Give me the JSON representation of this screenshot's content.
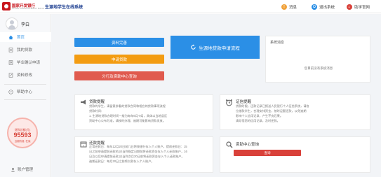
{
  "header": {
    "brand": "国家开发银行",
    "brand_sub": "CHINA DEVELOPMENT BANK",
    "system_title": "生源地学生在线系统",
    "links": [
      {
        "label": "消息",
        "icon": "bell-icon",
        "color": "#f0a23b"
      },
      {
        "label": "退出系统",
        "icon": "logout-icon",
        "color": "#2b8fe6"
      },
      {
        "label": "助学官网",
        "icon": "home-icon",
        "color": "#d9413a"
      }
    ]
  },
  "sidebar": {
    "username": "李白",
    "items": [
      {
        "label": "首页",
        "icon": "home-icon"
      },
      {
        "label": "我的贷款",
        "icon": "loan-icon"
      },
      {
        "label": "毕业确认申请",
        "icon": "graduation-icon"
      },
      {
        "label": "资料修改",
        "icon": "edit-icon"
      },
      {
        "label": "帮助中心",
        "icon": "help-icon"
      }
    ],
    "gauge": {
      "caption": "贷款总额(元)",
      "value": "95593",
      "sub": "当前阶段: 在读"
    },
    "account_label": "账户管理"
  },
  "main": {
    "buttons": [
      {
        "label": "资料完善",
        "color": "#2b8fe6"
      },
      {
        "label": "申请贷款",
        "color": "#f39c12"
      },
      {
        "label": "分行及资助中心查询",
        "color": "#e05a4e"
      }
    ],
    "continue_button": "生源地贷款申请流程",
    "system_message": {
      "title": "系统消息",
      "empty": "您目前没有系统消息"
    },
    "loan_notice": {
      "title": "贷款提醒",
      "lines": [
        "贷款的学生，请留意参看的贷款合同和相应的贷款事项流程",
        "贷款时间：",
        "1. 生源地贷款办理时间一般为每年6月-9月，具体以当地县区",
        "资助中心公布为准，请按时办理，逾期可能影响贷款发放。"
      ]
    },
    "certificate_notice": {
      "title": "证信提醒",
      "lines": [
        "贷款时限，还款记录已报送人民银行个人征信系统，请各",
        "位借款学生，合理安排资金，按时足额还款，以免逾期",
        "影响个人信用记录，产生不良后果。",
        "请珍惜您的信用记录，及时还款。"
      ]
    },
    "repay_notice": {
      "title": "还款提醒",
      "lines": [
        "正常还款日：每年12月20日前几日将按银行存入个人账户。提前还款日：15",
        "日之前申请提前还款的,应当到指定日期前将还款资金存入个人还款账户，16",
        "日及以后申请提前还款,应当到次月20日前将还款资金存入个人还款账户。",
        "逾期还款日：每月20日之前将欠款存入个人账户。"
      ]
    },
    "help_center": {
      "title": "资助中心查询",
      "button": "查询"
    }
  }
}
